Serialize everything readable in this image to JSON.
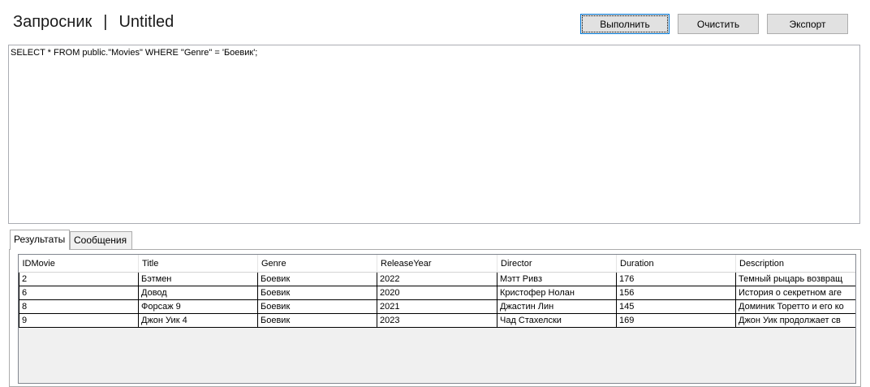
{
  "header": {
    "app_name": "Запросник",
    "separator": "|",
    "doc_name": "Untitled"
  },
  "toolbar": {
    "run_label": "Выполнить",
    "clear_label": "Очистить",
    "export_label": "Экспорт"
  },
  "editor": {
    "query": "SELECT * FROM public.\"Movies\" WHERE \"Genre\" = 'Боевик';"
  },
  "tabs": [
    {
      "label": "Результаты",
      "active": true
    },
    {
      "label": "Сообщения",
      "active": false
    }
  ],
  "results": {
    "columns": [
      "IDMovie",
      "Title",
      "Genre",
      "ReleaseYear",
      "Director",
      "Duration",
      "Description"
    ],
    "rows": [
      [
        "2",
        "Бэтмен",
        "Боевик",
        "2022",
        "Мэтт Ривз",
        "176",
        "Темный рыцарь возвращ"
      ],
      [
        "6",
        "Довод",
        "Боевик",
        "2020",
        "Кристофер Нолан",
        "156",
        "История о секретном аге"
      ],
      [
        "8",
        "Форсаж 9",
        "Боевик",
        "2021",
        "Джастин Лин",
        "145",
        "Доминик Торетто и его ко"
      ],
      [
        "9",
        "Джон Уик 4",
        "Боевик",
        "2023",
        "Чад Стахелски",
        "169",
        "Джон Уик продолжает св"
      ]
    ]
  }
}
